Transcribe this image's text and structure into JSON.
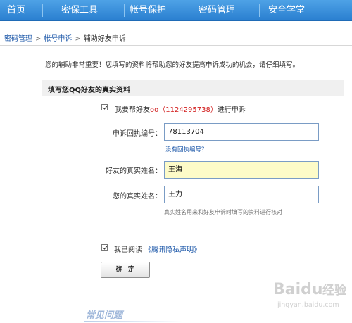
{
  "nav": {
    "items": [
      "首页",
      "密保工具",
      "帐号保护",
      "密码管理",
      "安全学堂"
    ]
  },
  "breadcrumb": {
    "items": [
      "密码管理",
      "帐号申诉",
      "辅助好友申诉"
    ],
    "separator": ">"
  },
  "notice": "您的辅助非常重要！您填写的资料将帮助您的好友提高申诉成功的机会，请仔细填写。",
  "section": {
    "title": "填写您QQ好友的真实资料"
  },
  "help": {
    "prefix": "我要帮好友",
    "friend": "oo（1124295738）",
    "suffix": "进行申诉"
  },
  "form": {
    "receipt_label": "申诉回执编号：",
    "receipt_value": "78113704",
    "no_receipt_link": "没有回执编号？",
    "friend_name_label": "好友的真实姓名：",
    "friend_name_value": "王海",
    "my_name_label": "您的真实姓名：",
    "my_name_value": "王力",
    "name_hint": "真实姓名用来和好友申诉时填写的资料进行核对"
  },
  "agreement": {
    "prefix": "我已阅读",
    "link": "《腾讯隐私声明》"
  },
  "confirm_label": "确定",
  "faq_title": "常见问题",
  "watermark": {
    "brand": "Baidu",
    "sub": "jingyan.baidu.com",
    "cn": "经验"
  },
  "colors": {
    "nav": "#2a7fd0",
    "link": "#1a56a8",
    "highlight": "#d21c1c",
    "focus_bg": "#fdfbc8"
  }
}
